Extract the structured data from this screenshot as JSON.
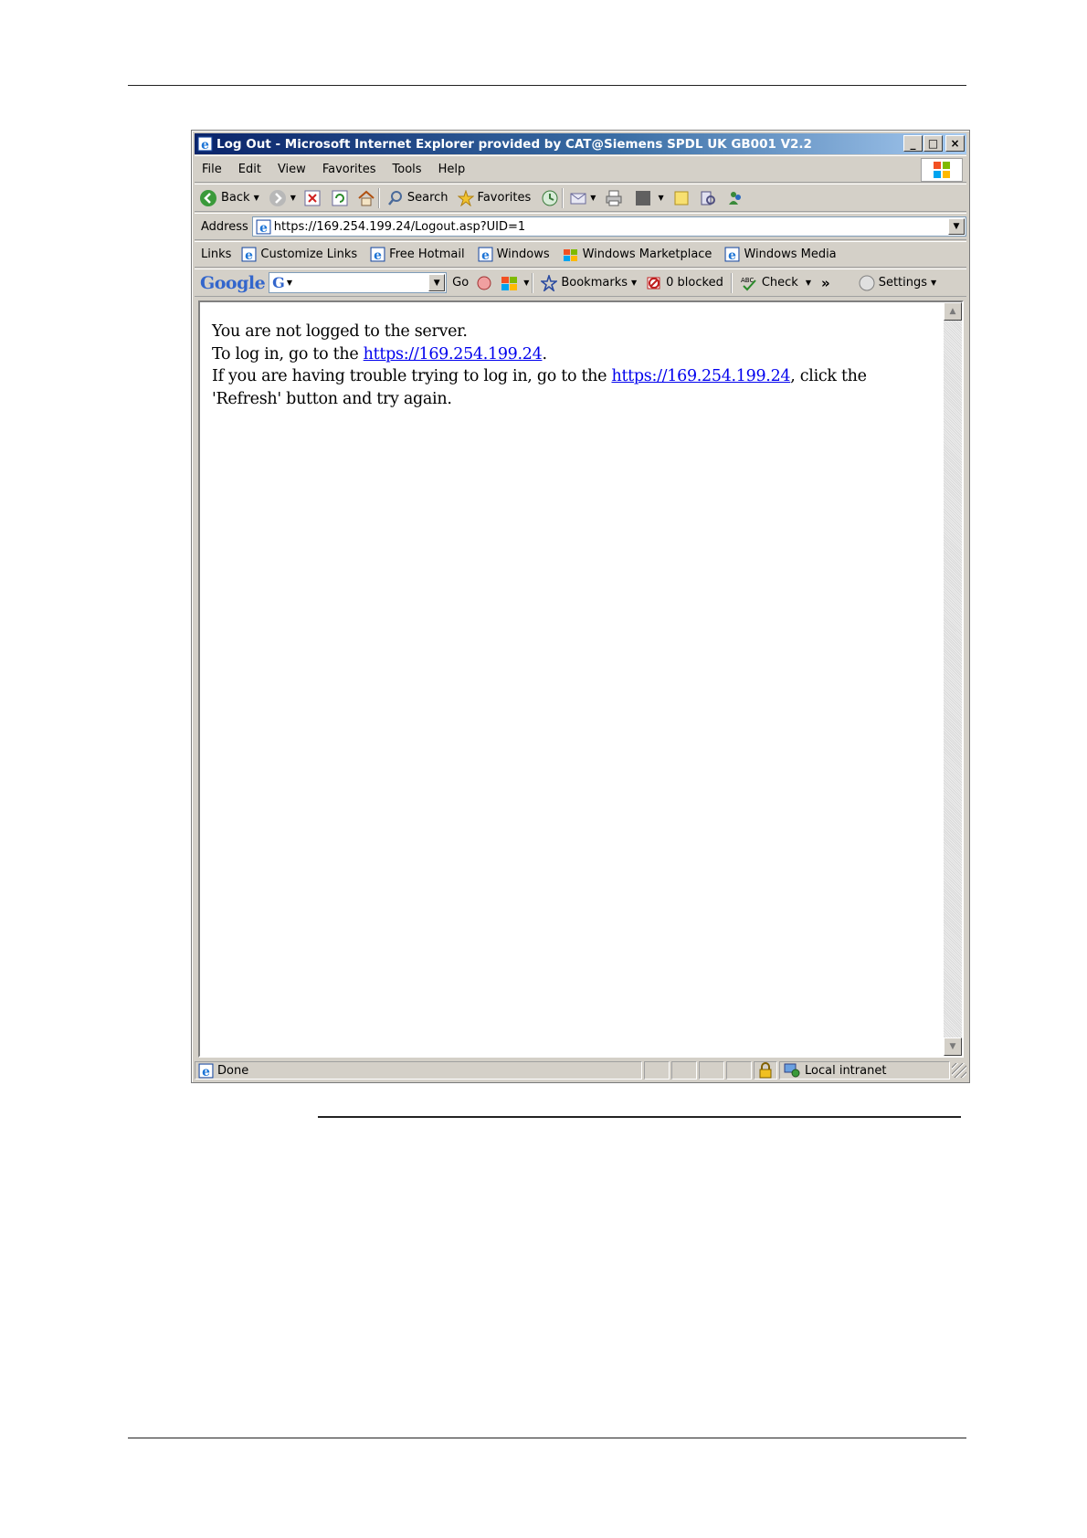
{
  "window": {
    "title": "Log Out - Microsoft Internet Explorer provided by CAT@Siemens SPDL UK GB001 V2.2",
    "controls": {
      "minimize": "_",
      "maximize": "□",
      "close": "×"
    }
  },
  "menu": [
    "File",
    "Edit",
    "View",
    "Favorites",
    "Tools",
    "Help"
  ],
  "toolbar": {
    "back_label": "Back",
    "search_label": "Search",
    "favorites_label": "Favorites"
  },
  "address": {
    "label": "Address",
    "url": "https://169.254.199.24/Logout.asp?UID=1"
  },
  "links": {
    "label": "Links",
    "items": [
      "Customize Links",
      "Free Hotmail",
      "Windows",
      "Windows Marketplace",
      "Windows Media"
    ]
  },
  "google_bar": {
    "logo": "Google",
    "go_label": "Go",
    "bookmarks_label": "Bookmarks",
    "blocked_label": "0 blocked",
    "check_label": "Check",
    "more_label": "»",
    "settings_label": "Settings"
  },
  "page": {
    "line1": "You are not logged to the server.",
    "line2_prefix": "To log in, go to the ",
    "line2_link": "https://169.254.199.24",
    "line2_suffix": ".",
    "line3_prefix": "If you are having trouble trying to log in, go to the ",
    "line3_link": "https://169.254.199.24",
    "line3_suffix": ", click the 'Refresh' button and try again."
  },
  "status": {
    "text": "Done",
    "zone": "Local intranet"
  },
  "colors": {
    "title_start": "#0a246a",
    "title_end": "#a6caf0",
    "chrome": "#d4d0c8",
    "link": "#0000ee"
  }
}
